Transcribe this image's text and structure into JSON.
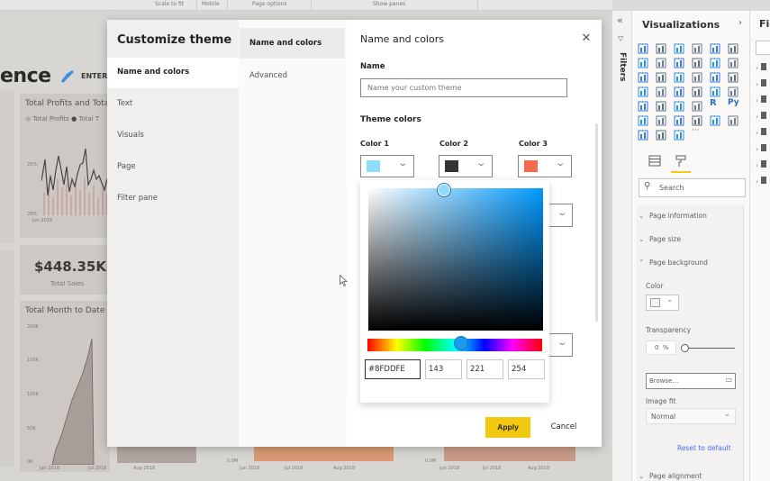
{
  "ribbon": {
    "groups": [
      "Scale to fit",
      "Mobile",
      "Page options",
      "Show panes"
    ]
  },
  "report": {
    "title_fragment": "ence",
    "logo_text": "ENTER",
    "cards": {
      "profits_chart": {
        "title": "Total Profits and Tota",
        "legend": [
          "Total Profits",
          "Total T"
        ],
        "y_ticks": [
          "25%",
          "20%"
        ],
        "x_ticks": [
          "Jun 2018"
        ]
      },
      "kpi": {
        "value": "$448.35K",
        "label": "Total Sales"
      },
      "mtd_chart": {
        "title": "Total Month to Date",
        "y_ticks": [
          "200K",
          "150K",
          "100K",
          "50K",
          "0K"
        ],
        "x_ticks": [
          "Jan 2018",
          "Jul 2018",
          "Aug 2018"
        ]
      },
      "bottom_charts": {
        "mid_y_tick": "0.0M",
        "mid_x_ticks": [
          "Jun 2018",
          "Jul 2018",
          "Aug 2018"
        ],
        "right_y_tick": "0.0M",
        "right_x_ticks": [
          "Jun 2018",
          "Jul 2018",
          "Aug 2018"
        ]
      }
    }
  },
  "dialog": {
    "title": "Customize theme",
    "nav_primary": [
      {
        "label": "Name and colors",
        "active": true
      },
      {
        "label": "Text",
        "active": false
      },
      {
        "label": "Visuals",
        "active": false
      },
      {
        "label": "Page",
        "active": false
      },
      {
        "label": "Filter pane",
        "active": false
      }
    ],
    "nav_secondary": [
      {
        "label": "Name and colors",
        "active": true
      },
      {
        "label": "Advanced",
        "active": false
      }
    ],
    "section_title": "Name and colors",
    "close_icon": "close-icon",
    "name_label": "Name",
    "name_placeholder": "Name your custom theme",
    "name_value": "",
    "theme_colors_label": "Theme colors",
    "colors": [
      {
        "label": "Color 1",
        "hex": "#8FDDFE"
      },
      {
        "label": "Color 2",
        "hex": "#333333"
      },
      {
        "label": "Color 3",
        "hex": "#F5694C"
      }
    ],
    "picker": {
      "hex": "#8FDDFE",
      "r": "143",
      "g": "221",
      "b": "254",
      "hue_color": "#0099FF"
    },
    "apply_label": "Apply",
    "cancel_label": "Cancel",
    "accent": "#F2C811"
  },
  "panes": {
    "filters_label": "Filters",
    "collapse_icon": "double-chevron-left-icon",
    "visualizations_title": "Visualizations",
    "fields_title_fragment": "Fie",
    "visual_icons": [
      "stacked-bar-icon",
      "stacked-column-icon",
      "clustered-bar-icon",
      "clustered-column-icon",
      "100-bar-icon",
      "100-column-icon",
      "line-chart-icon",
      "area-chart-icon",
      "stacked-area-icon",
      "line-column-icon",
      "line-clustered-icon",
      "ribbon-chart-icon",
      "waterfall-icon",
      "funnel-icon",
      "scatter-icon",
      "pie-icon",
      "donut-icon",
      "treemap-icon",
      "map-icon",
      "filled-map-icon",
      "shape-map-icon",
      "gauge-icon",
      "card-icon",
      "multirow-card-icon",
      "kpi-icon",
      "slicer-icon",
      "table-icon",
      "matrix-icon",
      "r-visual-icon",
      "python-visual-icon",
      "key-influencers-icon",
      "decomposition-tree-icon",
      "qa-icon",
      "smart-narrative-icon",
      "trophy-icon",
      "paginated-report-icon",
      "arcgis-icon",
      "power-apps-icon",
      "power-automate-icon",
      "more-visuals-icon"
    ],
    "format_tabs": [
      "fields-tab-icon",
      "format-paint-roller-icon"
    ],
    "search_placeholder": "Search",
    "format_sections": [
      {
        "label": "Page information",
        "expanded": false
      },
      {
        "label": "Page size",
        "expanded": false
      },
      {
        "label": "Page background",
        "expanded": true
      }
    ],
    "background": {
      "color_label": "Color",
      "transparency_label": "Transparency",
      "transparency_value": "0",
      "transparency_unit": "%",
      "transparency_percent": 0,
      "browse_label": "Browse...",
      "image_fit_label": "Image fit",
      "image_fit_value": "Normal",
      "reset_label": "Reset to default"
    },
    "page_alignment_label": "Page alignment"
  }
}
